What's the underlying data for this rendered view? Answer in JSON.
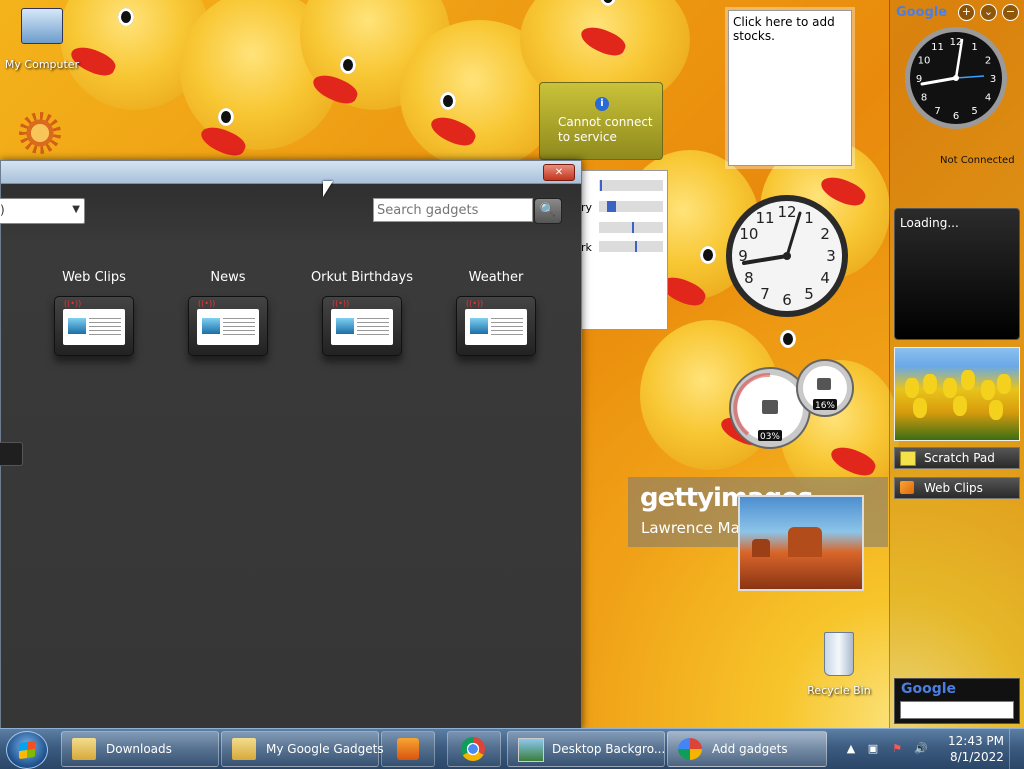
{
  "desktop": {
    "icons": [
      {
        "label": "My Computer"
      },
      {
        "label": ""
      },
      {
        "label": "Recycle Bin"
      }
    ]
  },
  "gadget_window": {
    "search_placeholder": "Search gadgets",
    "select_value": ")",
    "tiles": [
      {
        "label": "Web Clips"
      },
      {
        "label": "News"
      },
      {
        "label": "Orkut Birthdays"
      },
      {
        "label": "Weather"
      }
    ]
  },
  "stocks": {
    "text": "Click here to add stocks."
  },
  "map_gadget": {
    "message": "Cannot connect to service",
    "info_glyph": "i"
  },
  "traffic": {
    "rows": [
      {
        "label": "",
        "fill": 0.02
      },
      {
        "label": "ry",
        "fill": 0.14
      },
      {
        "label": "",
        "fill": 0.55
      },
      {
        "label": "rk",
        "fill": 0.6
      }
    ]
  },
  "meter": {
    "cpu": "03%",
    "memory": "16%"
  },
  "getty": {
    "brand": "gettyimages",
    "credit": "Lawrence Ma"
  },
  "sidebar": {
    "logo": "Google",
    "buttons": [
      "+",
      "⌄",
      "−"
    ],
    "clock_status": "Not Connected",
    "loading": "Loading...",
    "items": [
      {
        "label": "Scratch Pad",
        "icon": "note-icon"
      },
      {
        "label": "Web Clips",
        "icon": "rss-icon"
      }
    ],
    "search_logo": "Google"
  },
  "taskbar": {
    "tasks": [
      {
        "label": "Downloads"
      },
      {
        "label": "My Google Gadgets"
      },
      {
        "label": "Desktop Backgro..."
      },
      {
        "label": "Add gadgets"
      }
    ],
    "time": "12:43 PM",
    "date": "8/1/2022"
  },
  "colors": {
    "accent": "#3b63c4",
    "close": "#c2361e",
    "taskbar": "#3c5c80"
  }
}
